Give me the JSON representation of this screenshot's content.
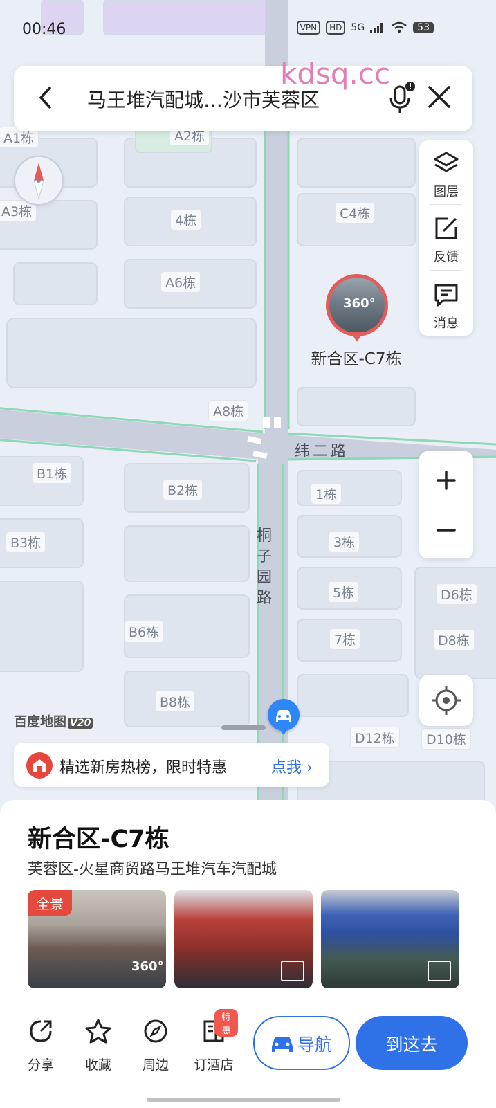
{
  "status": {
    "time": "00:46",
    "vpn": "VPN",
    "hd": "HD",
    "network": "5G",
    "battery": "53"
  },
  "search": {
    "query": "马王堆汽配城…沙市芙蓉区"
  },
  "watermark": "kdsq.cc",
  "right_panel": {
    "layers_label": "图层",
    "feedback_label": "反馈",
    "messages_label": "消息"
  },
  "map": {
    "labels": [
      "A1栋",
      "A2栋",
      "A3栋",
      "4栋",
      "C4栋",
      "A6栋",
      "A8栋",
      "B1栋",
      "B2栋",
      "1栋",
      "B3栋",
      "3栋",
      "5栋",
      "D6栋",
      "B6栋",
      "7栋",
      "D8栋",
      "B8栋",
      "D12栋",
      "D10栋"
    ],
    "road_east_west": "纬二路",
    "road_north_south": "桐子园路",
    "marker_title": "新合区-C7栋",
    "marker_badge": "360°",
    "brand": "百度地图",
    "brand_version": "V20"
  },
  "promo": {
    "text": "精选新房热榜，限时特惠",
    "cta": "点我 ›"
  },
  "place": {
    "title": "新合区-C7栋",
    "address": "芙蓉区-火星商贸路马王堆汽车汽配城",
    "photo1_badge": "全景",
    "photo1_360": "360°"
  },
  "bottom_bar": {
    "share": "分享",
    "favorite": "收藏",
    "nearby": "周边",
    "hotel": "订酒店",
    "hotel_badge": "特惠",
    "navigate": "导航",
    "go_here": "到这去"
  },
  "colors": {
    "accent": "#2f72e8",
    "marker": "#e55b5b",
    "road": "#c9cfdc",
    "road_edge": "#8ed8b6"
  }
}
